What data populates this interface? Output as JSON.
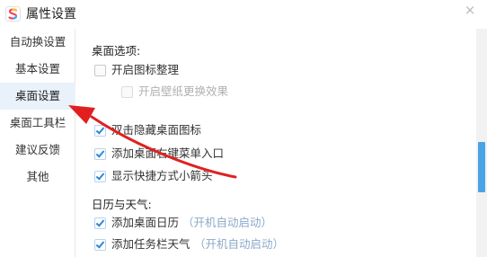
{
  "window": {
    "title": "属性设置",
    "close_glyph": "×",
    "logo_icon": "app-logo-icon"
  },
  "sidebar": {
    "items": [
      {
        "label": "自动换设置",
        "active": false
      },
      {
        "label": "基本设置",
        "active": false
      },
      {
        "label": "桌面设置",
        "active": true
      },
      {
        "label": "桌面工具栏",
        "active": false
      },
      {
        "label": "建议反馈",
        "active": false
      },
      {
        "label": "其他",
        "active": false
      }
    ]
  },
  "desktop_options": {
    "title": "桌面选项:",
    "items": [
      {
        "label": "开启图标整理",
        "checked": false
      },
      {
        "label": "开启壁纸更换效果",
        "checked": false,
        "disabled": true
      },
      {
        "label": "双击隐藏桌面图标",
        "checked": true
      },
      {
        "label": "添加桌面右键菜单入口",
        "checked": true
      },
      {
        "label": "显示快捷方式小箭头",
        "checked": true
      }
    ]
  },
  "calendar_weather": {
    "title": "日历与天气:",
    "items": [
      {
        "label": "添加桌面日历",
        "hint": "（开机自动启动）",
        "checked": true
      },
      {
        "label": "添加任务栏天气",
        "hint": "（开机自动启动）",
        "checked": true
      }
    ]
  },
  "annotation": {
    "arrow_color": "#e02020"
  },
  "colors": {
    "accent": "#2f86d6",
    "scroll_thumb": "#4aa3e6",
    "active_nav_bg": "#e9f1fa"
  }
}
